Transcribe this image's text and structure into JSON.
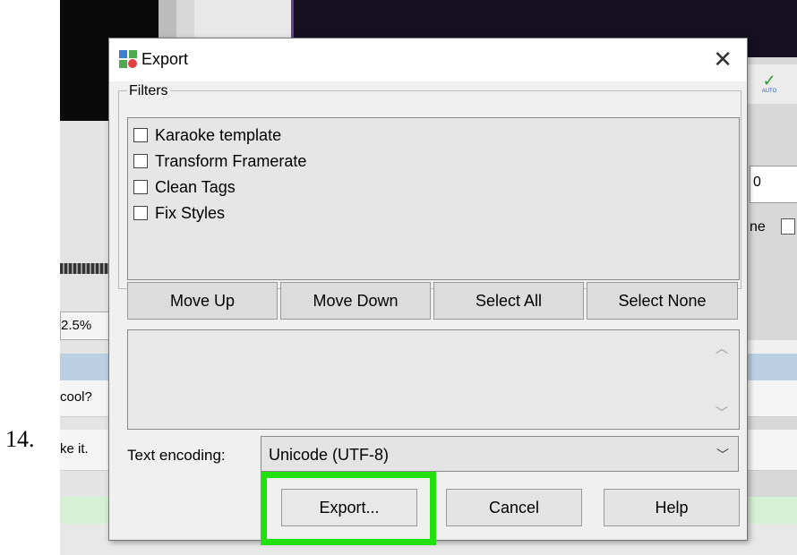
{
  "step_number": "14.",
  "background": {
    "zoom_value": "2.5%",
    "field_value": "0",
    "partial_label": "ne",
    "row1_text": "cool?",
    "row2_text": "ke it.",
    "auto_label": "AUTO"
  },
  "dialog": {
    "title": "Export",
    "close_glyph": "✕",
    "filters_label": "Filters",
    "filters": [
      {
        "label": "Karaoke template",
        "checked": false
      },
      {
        "label": "Transform Framerate",
        "checked": false
      },
      {
        "label": "Clean Tags",
        "checked": false
      },
      {
        "label": "Fix Styles",
        "checked": false
      }
    ],
    "list_buttons": {
      "move_up": "Move Up",
      "move_down": "Move Down",
      "select_all": "Select All",
      "select_none": "Select None"
    },
    "encoding": {
      "label": "Text encoding:",
      "value": "Unicode (UTF-8)"
    },
    "footer_buttons": {
      "export": "Export...",
      "cancel": "Cancel",
      "help": "Help"
    },
    "highlight_color": "#22e010"
  }
}
